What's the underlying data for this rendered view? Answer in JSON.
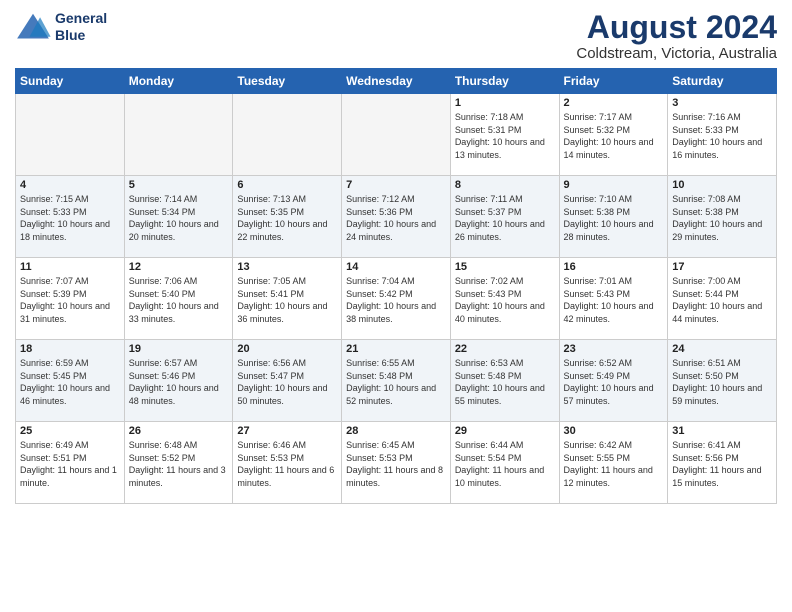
{
  "header": {
    "logo_line1": "General",
    "logo_line2": "Blue",
    "month_year": "August 2024",
    "location": "Coldstream, Victoria, Australia"
  },
  "days_of_week": [
    "Sunday",
    "Monday",
    "Tuesday",
    "Wednesday",
    "Thursday",
    "Friday",
    "Saturday"
  ],
  "weeks": [
    [
      {
        "day": "",
        "sunrise": "",
        "sunset": "",
        "daylight": "",
        "empty": true
      },
      {
        "day": "",
        "sunrise": "",
        "sunset": "",
        "daylight": "",
        "empty": true
      },
      {
        "day": "",
        "sunrise": "",
        "sunset": "",
        "daylight": "",
        "empty": true
      },
      {
        "day": "",
        "sunrise": "",
        "sunset": "",
        "daylight": "",
        "empty": true
      },
      {
        "day": "1",
        "sunrise": "Sunrise: 7:18 AM",
        "sunset": "Sunset: 5:31 PM",
        "daylight": "Daylight: 10 hours and 13 minutes.",
        "empty": false
      },
      {
        "day": "2",
        "sunrise": "Sunrise: 7:17 AM",
        "sunset": "Sunset: 5:32 PM",
        "daylight": "Daylight: 10 hours and 14 minutes.",
        "empty": false
      },
      {
        "day": "3",
        "sunrise": "Sunrise: 7:16 AM",
        "sunset": "Sunset: 5:33 PM",
        "daylight": "Daylight: 10 hours and 16 minutes.",
        "empty": false
      }
    ],
    [
      {
        "day": "4",
        "sunrise": "Sunrise: 7:15 AM",
        "sunset": "Sunset: 5:33 PM",
        "daylight": "Daylight: 10 hours and 18 minutes.",
        "empty": false
      },
      {
        "day": "5",
        "sunrise": "Sunrise: 7:14 AM",
        "sunset": "Sunset: 5:34 PM",
        "daylight": "Daylight: 10 hours and 20 minutes.",
        "empty": false
      },
      {
        "day": "6",
        "sunrise": "Sunrise: 7:13 AM",
        "sunset": "Sunset: 5:35 PM",
        "daylight": "Daylight: 10 hours and 22 minutes.",
        "empty": false
      },
      {
        "day": "7",
        "sunrise": "Sunrise: 7:12 AM",
        "sunset": "Sunset: 5:36 PM",
        "daylight": "Daylight: 10 hours and 24 minutes.",
        "empty": false
      },
      {
        "day": "8",
        "sunrise": "Sunrise: 7:11 AM",
        "sunset": "Sunset: 5:37 PM",
        "daylight": "Daylight: 10 hours and 26 minutes.",
        "empty": false
      },
      {
        "day": "9",
        "sunrise": "Sunrise: 7:10 AM",
        "sunset": "Sunset: 5:38 PM",
        "daylight": "Daylight: 10 hours and 28 minutes.",
        "empty": false
      },
      {
        "day": "10",
        "sunrise": "Sunrise: 7:08 AM",
        "sunset": "Sunset: 5:38 PM",
        "daylight": "Daylight: 10 hours and 29 minutes.",
        "empty": false
      }
    ],
    [
      {
        "day": "11",
        "sunrise": "Sunrise: 7:07 AM",
        "sunset": "Sunset: 5:39 PM",
        "daylight": "Daylight: 10 hours and 31 minutes.",
        "empty": false
      },
      {
        "day": "12",
        "sunrise": "Sunrise: 7:06 AM",
        "sunset": "Sunset: 5:40 PM",
        "daylight": "Daylight: 10 hours and 33 minutes.",
        "empty": false
      },
      {
        "day": "13",
        "sunrise": "Sunrise: 7:05 AM",
        "sunset": "Sunset: 5:41 PM",
        "daylight": "Daylight: 10 hours and 36 minutes.",
        "empty": false
      },
      {
        "day": "14",
        "sunrise": "Sunrise: 7:04 AM",
        "sunset": "Sunset: 5:42 PM",
        "daylight": "Daylight: 10 hours and 38 minutes.",
        "empty": false
      },
      {
        "day": "15",
        "sunrise": "Sunrise: 7:02 AM",
        "sunset": "Sunset: 5:43 PM",
        "daylight": "Daylight: 10 hours and 40 minutes.",
        "empty": false
      },
      {
        "day": "16",
        "sunrise": "Sunrise: 7:01 AM",
        "sunset": "Sunset: 5:43 PM",
        "daylight": "Daylight: 10 hours and 42 minutes.",
        "empty": false
      },
      {
        "day": "17",
        "sunrise": "Sunrise: 7:00 AM",
        "sunset": "Sunset: 5:44 PM",
        "daylight": "Daylight: 10 hours and 44 minutes.",
        "empty": false
      }
    ],
    [
      {
        "day": "18",
        "sunrise": "Sunrise: 6:59 AM",
        "sunset": "Sunset: 5:45 PM",
        "daylight": "Daylight: 10 hours and 46 minutes.",
        "empty": false
      },
      {
        "day": "19",
        "sunrise": "Sunrise: 6:57 AM",
        "sunset": "Sunset: 5:46 PM",
        "daylight": "Daylight: 10 hours and 48 minutes.",
        "empty": false
      },
      {
        "day": "20",
        "sunrise": "Sunrise: 6:56 AM",
        "sunset": "Sunset: 5:47 PM",
        "daylight": "Daylight: 10 hours and 50 minutes.",
        "empty": false
      },
      {
        "day": "21",
        "sunrise": "Sunrise: 6:55 AM",
        "sunset": "Sunset: 5:48 PM",
        "daylight": "Daylight: 10 hours and 52 minutes.",
        "empty": false
      },
      {
        "day": "22",
        "sunrise": "Sunrise: 6:53 AM",
        "sunset": "Sunset: 5:48 PM",
        "daylight": "Daylight: 10 hours and 55 minutes.",
        "empty": false
      },
      {
        "day": "23",
        "sunrise": "Sunrise: 6:52 AM",
        "sunset": "Sunset: 5:49 PM",
        "daylight": "Daylight: 10 hours and 57 minutes.",
        "empty": false
      },
      {
        "day": "24",
        "sunrise": "Sunrise: 6:51 AM",
        "sunset": "Sunset: 5:50 PM",
        "daylight": "Daylight: 10 hours and 59 minutes.",
        "empty": false
      }
    ],
    [
      {
        "day": "25",
        "sunrise": "Sunrise: 6:49 AM",
        "sunset": "Sunset: 5:51 PM",
        "daylight": "Daylight: 11 hours and 1 minute.",
        "empty": false
      },
      {
        "day": "26",
        "sunrise": "Sunrise: 6:48 AM",
        "sunset": "Sunset: 5:52 PM",
        "daylight": "Daylight: 11 hours and 3 minutes.",
        "empty": false
      },
      {
        "day": "27",
        "sunrise": "Sunrise: 6:46 AM",
        "sunset": "Sunset: 5:53 PM",
        "daylight": "Daylight: 11 hours and 6 minutes.",
        "empty": false
      },
      {
        "day": "28",
        "sunrise": "Sunrise: 6:45 AM",
        "sunset": "Sunset: 5:53 PM",
        "daylight": "Daylight: 11 hours and 8 minutes.",
        "empty": false
      },
      {
        "day": "29",
        "sunrise": "Sunrise: 6:44 AM",
        "sunset": "Sunset: 5:54 PM",
        "daylight": "Daylight: 11 hours and 10 minutes.",
        "empty": false
      },
      {
        "day": "30",
        "sunrise": "Sunrise: 6:42 AM",
        "sunset": "Sunset: 5:55 PM",
        "daylight": "Daylight: 11 hours and 12 minutes.",
        "empty": false
      },
      {
        "day": "31",
        "sunrise": "Sunrise: 6:41 AM",
        "sunset": "Sunset: 5:56 PM",
        "daylight": "Daylight: 11 hours and 15 minutes.",
        "empty": false
      }
    ]
  ]
}
